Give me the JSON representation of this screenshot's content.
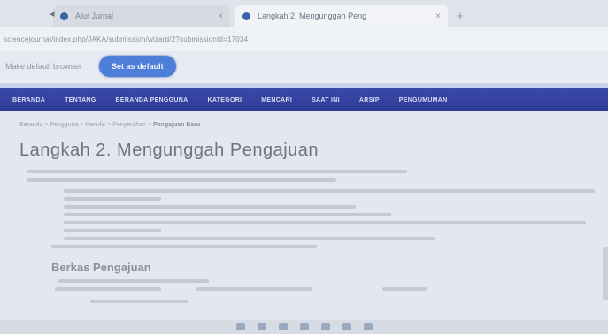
{
  "browser": {
    "tabs": [
      {
        "title": "Alur Jurnal",
        "active": false
      },
      {
        "title": "Langkah 2. Mengunggah Peng",
        "active": true
      }
    ],
    "url": "sciencejournal/index.php/JAKA/submission/wizard/2?submissionId=17034",
    "infobar": {
      "text": "Make default browser",
      "button_label": "Set as default"
    }
  },
  "sitenav": {
    "items": [
      "BERANDA",
      "TENTANG",
      "BERANDA PENGGUNA",
      "KATEGORI",
      "MENCARI",
      "SAAT INI",
      "ARSIP",
      "PENGUMUMAN"
    ]
  },
  "content": {
    "breadcrumb": "Beranda > Pengguna > Penulis > Penyerahan > ",
    "breadcrumb_current": "Pengajuan Baru",
    "page_title": "Langkah 2. Mengunggah Pengajuan",
    "section_title": "Berkas Pengajuan"
  },
  "colors": {
    "nav_bg": "#2f3c97",
    "button_bg": "#4d7fd9"
  }
}
